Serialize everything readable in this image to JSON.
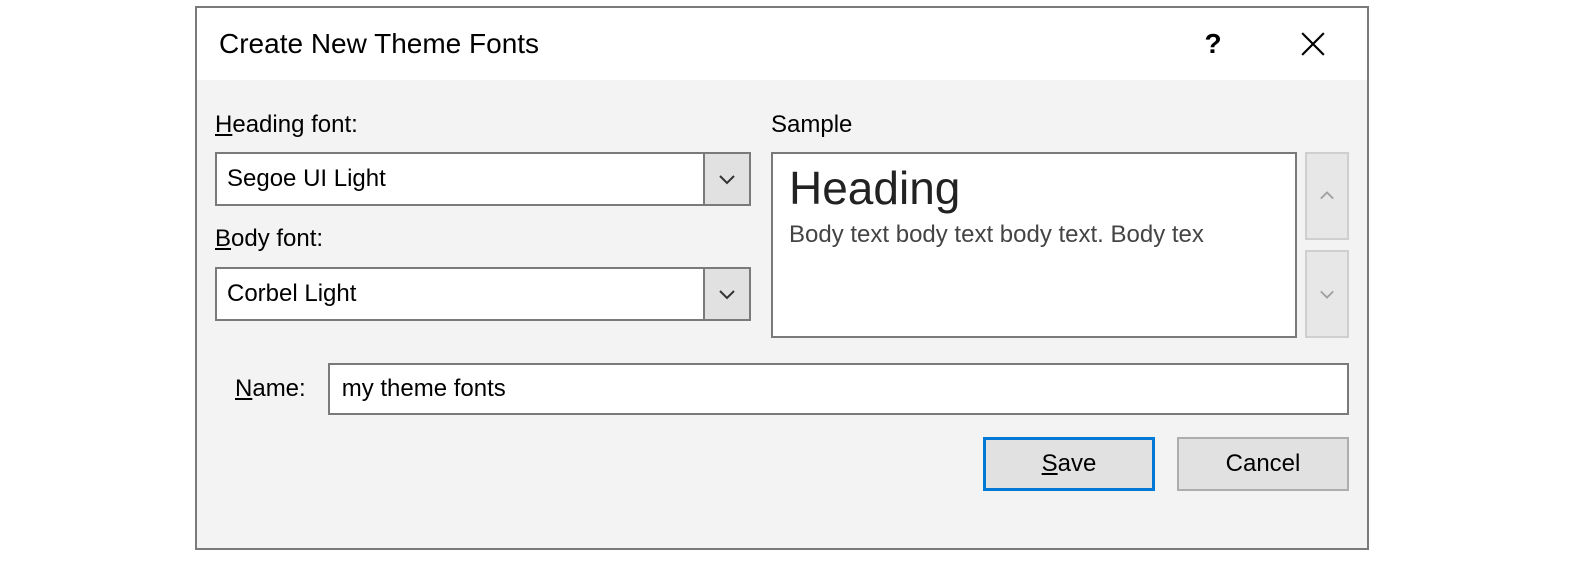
{
  "dialog": {
    "title": "Create New Theme Fonts",
    "help_symbol": "?",
    "close_label": "Close"
  },
  "heading_font": {
    "label_before": "H",
    "label_after": "eading font:",
    "value": "Segoe UI Light"
  },
  "body_font": {
    "label_before": "B",
    "label_after": "ody font:",
    "value": "Corbel Light"
  },
  "sample": {
    "label": "Sample",
    "heading_text": "Heading",
    "body_text": "Body text body text body text. Body tex"
  },
  "name": {
    "label_before": "N",
    "label_after": "ame:",
    "value": "my theme fonts"
  },
  "buttons": {
    "save_before": "S",
    "save_after": "ave",
    "cancel": "Cancel"
  }
}
